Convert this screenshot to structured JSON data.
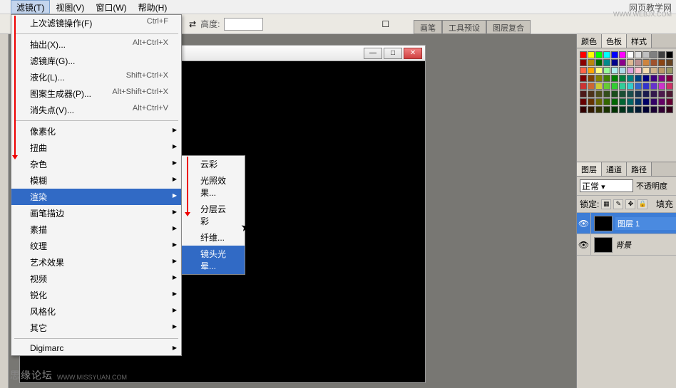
{
  "menubar": {
    "items": [
      {
        "label": "滤镜(T)"
      },
      {
        "label": "视图(V)"
      },
      {
        "label": "窗口(W)"
      },
      {
        "label": "帮助(H)"
      }
    ]
  },
  "toolbar": {
    "height_label": "高度:"
  },
  "right_tabs": [
    "画笔",
    "工具预设",
    "图层复合"
  ],
  "filter_menu": {
    "last": {
      "label": "上次滤镜操作(F)",
      "shortcut": "Ctrl+F"
    },
    "extract": {
      "label": "抽出(X)...",
      "shortcut": "Alt+Ctrl+X"
    },
    "gallery": {
      "label": "滤镜库(G)..."
    },
    "liquify": {
      "label": "液化(L)...",
      "shortcut": "Shift+Ctrl+X"
    },
    "pattern": {
      "label": "图案生成器(P)...",
      "shortcut": "Alt+Shift+Ctrl+X"
    },
    "vanish": {
      "label": "消失点(V)...",
      "shortcut": "Alt+Ctrl+V"
    },
    "pixelate": {
      "label": "像素化"
    },
    "distort": {
      "label": "扭曲"
    },
    "noise": {
      "label": "杂色"
    },
    "blur": {
      "label": "模糊"
    },
    "render": {
      "label": "渲染"
    },
    "brush": {
      "label": "画笔描边"
    },
    "sketch": {
      "label": "素描"
    },
    "texture": {
      "label": "纹理"
    },
    "artistic": {
      "label": "艺术效果"
    },
    "video": {
      "label": "视频"
    },
    "sharpen": {
      "label": "锐化"
    },
    "stylize": {
      "label": "风格化"
    },
    "other": {
      "label": "其它"
    },
    "digimarc": {
      "label": "Digimarc"
    }
  },
  "render_submenu": {
    "clouds": "云彩",
    "lighting": "光照效果...",
    "diff_clouds": "分层云彩",
    "fibers": "纤维...",
    "lens_flare": "镜头光晕..."
  },
  "swatch_panel": {
    "tabs": [
      "颜色",
      "色板",
      "样式"
    ]
  },
  "layers_panel": {
    "tabs": [
      "图层",
      "通道",
      "路径"
    ],
    "blend_mode": "正常",
    "opacity_label": "不透明度",
    "lock_label": "锁定:",
    "fill_label": "填充",
    "layers": [
      {
        "name": "图层 1"
      },
      {
        "name": "背景"
      }
    ]
  },
  "swatch_colors": [
    "#ff0000",
    "#ffff00",
    "#00ff00",
    "#00ffff",
    "#0000ff",
    "#ff00ff",
    "#ffffff",
    "#e0e0e0",
    "#c0c0c0",
    "#808080",
    "#404040",
    "#000000",
    "#8b0000",
    "#b8860b",
    "#006400",
    "#008b8b",
    "#00008b",
    "#8b008b",
    "#ddb892",
    "#bc8f8f",
    "#cd853f",
    "#a0522d",
    "#8b4513",
    "#654321",
    "#ff6347",
    "#ffa500",
    "#ffff80",
    "#98fb98",
    "#afeeee",
    "#add8e6",
    "#dda0dd",
    "#ffc0cb",
    "#f5deb3",
    "#d2b48c",
    "#bc9a6a",
    "#999966",
    "#800000",
    "#804000",
    "#808000",
    "#408000",
    "#008000",
    "#008040",
    "#008080",
    "#004080",
    "#000080",
    "#400080",
    "#800080",
    "#800040",
    "#cc3333",
    "#cc6633",
    "#cccc33",
    "#66cc33",
    "#33cc33",
    "#33cc99",
    "#33cccc",
    "#3366cc",
    "#3333cc",
    "#6633cc",
    "#cc33cc",
    "#cc3366",
    "#4d1a1a",
    "#4d331a",
    "#4d4d1a",
    "#334d1a",
    "#1a4d1a",
    "#1a4d33",
    "#1a4d4d",
    "#1a334d",
    "#1a1a4d",
    "#331a4d",
    "#4d1a4d",
    "#4d1a33",
    "#660000",
    "#663300",
    "#666600",
    "#336600",
    "#006600",
    "#006633",
    "#006666",
    "#003366",
    "#000066",
    "#330066",
    "#660066",
    "#660033",
    "#330000",
    "#331a00",
    "#333300",
    "#1a3300",
    "#003300",
    "#00331a",
    "#003333",
    "#001a33",
    "#000033",
    "#1a0033",
    "#330033",
    "#33001a"
  ],
  "watermarks": {
    "top_right": "网页教学网",
    "top_right_url": "WWW.WEBJX.COM",
    "bottom_left": "思缘论坛",
    "bottom_left_url": "WWW.MISSYUAN.COM"
  }
}
